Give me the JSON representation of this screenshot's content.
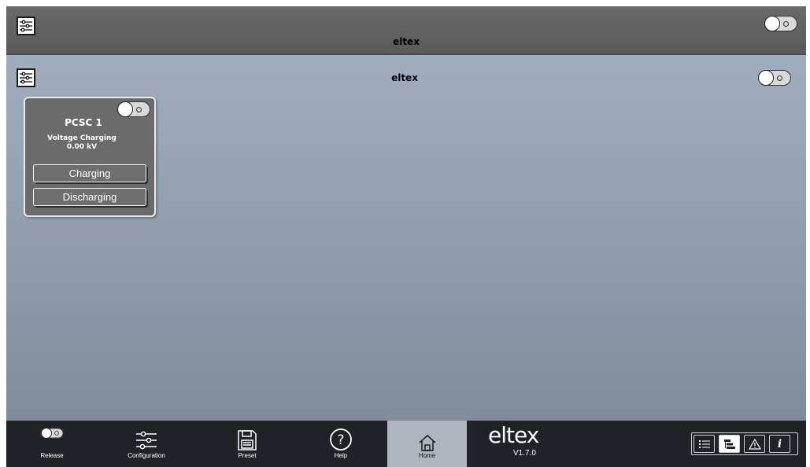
{
  "top_bar": {
    "title": "eltex",
    "settings_icon": "sliders-icon",
    "toggle_state": "off"
  },
  "section": {
    "title": "eltex",
    "settings_icon": "sliders-icon",
    "toggle_state": "off"
  },
  "card": {
    "title": "PCSC 1",
    "status_label": "Voltage Charging",
    "status_value": "0.00 kV",
    "toggle_state": "off",
    "buttons": [
      "Charging",
      "Discharging"
    ]
  },
  "nav": {
    "release": "Release",
    "configuration": "Configuration",
    "preset": "Preset",
    "help": "Help",
    "home": "Home",
    "active": "Home"
  },
  "brand": {
    "logo": "eltex",
    "version": "V1.7.0"
  },
  "tools": {
    "items": [
      "list-icon",
      "tree-icon",
      "warning-icon",
      "info-icon"
    ],
    "active": "tree-icon",
    "info_glyph": "i"
  },
  "colors": {
    "background_top": "#a3b1c3",
    "background_bottom": "#808c9b",
    "bar": "#5a5a5a",
    "card": "#6b6b6b",
    "nav": "#1f2328",
    "nav_active": "#aeb5bd"
  }
}
